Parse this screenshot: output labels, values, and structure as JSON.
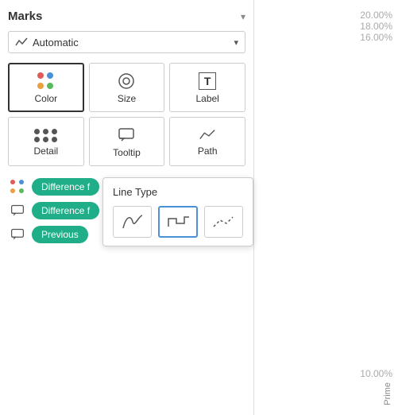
{
  "marks": {
    "title": "Marks",
    "dropdown_arrow": "▾",
    "automatic": {
      "label": "Automatic",
      "arrow": "▾"
    },
    "cells": [
      {
        "id": "color",
        "label": "Color",
        "selected": true
      },
      {
        "id": "size",
        "label": "Size",
        "selected": false
      },
      {
        "id": "label",
        "label": "Label",
        "selected": false
      },
      {
        "id": "detail",
        "label": "Detail",
        "selected": false
      },
      {
        "id": "tooltip",
        "label": "Tooltip",
        "selected": false
      },
      {
        "id": "path",
        "label": "Path",
        "selected": false
      }
    ],
    "pills": [
      {
        "id": "pill1",
        "text": "Difference f",
        "icon": "color-dots"
      },
      {
        "id": "pill2",
        "text": "Difference f",
        "icon": "tooltip"
      },
      {
        "id": "pill3",
        "text": "Previous",
        "icon": "tooltip"
      }
    ]
  },
  "line_type_popup": {
    "title": "Line Type",
    "options": [
      {
        "id": "curved",
        "label": "curved-line"
      },
      {
        "id": "step",
        "label": "step-line",
        "selected": true
      },
      {
        "id": "dash",
        "label": "dash-line"
      }
    ]
  },
  "axis": {
    "labels": [
      "20.00%",
      "18.00%",
      "16.00%",
      "10.00%"
    ],
    "bottom_label": "Prime"
  }
}
